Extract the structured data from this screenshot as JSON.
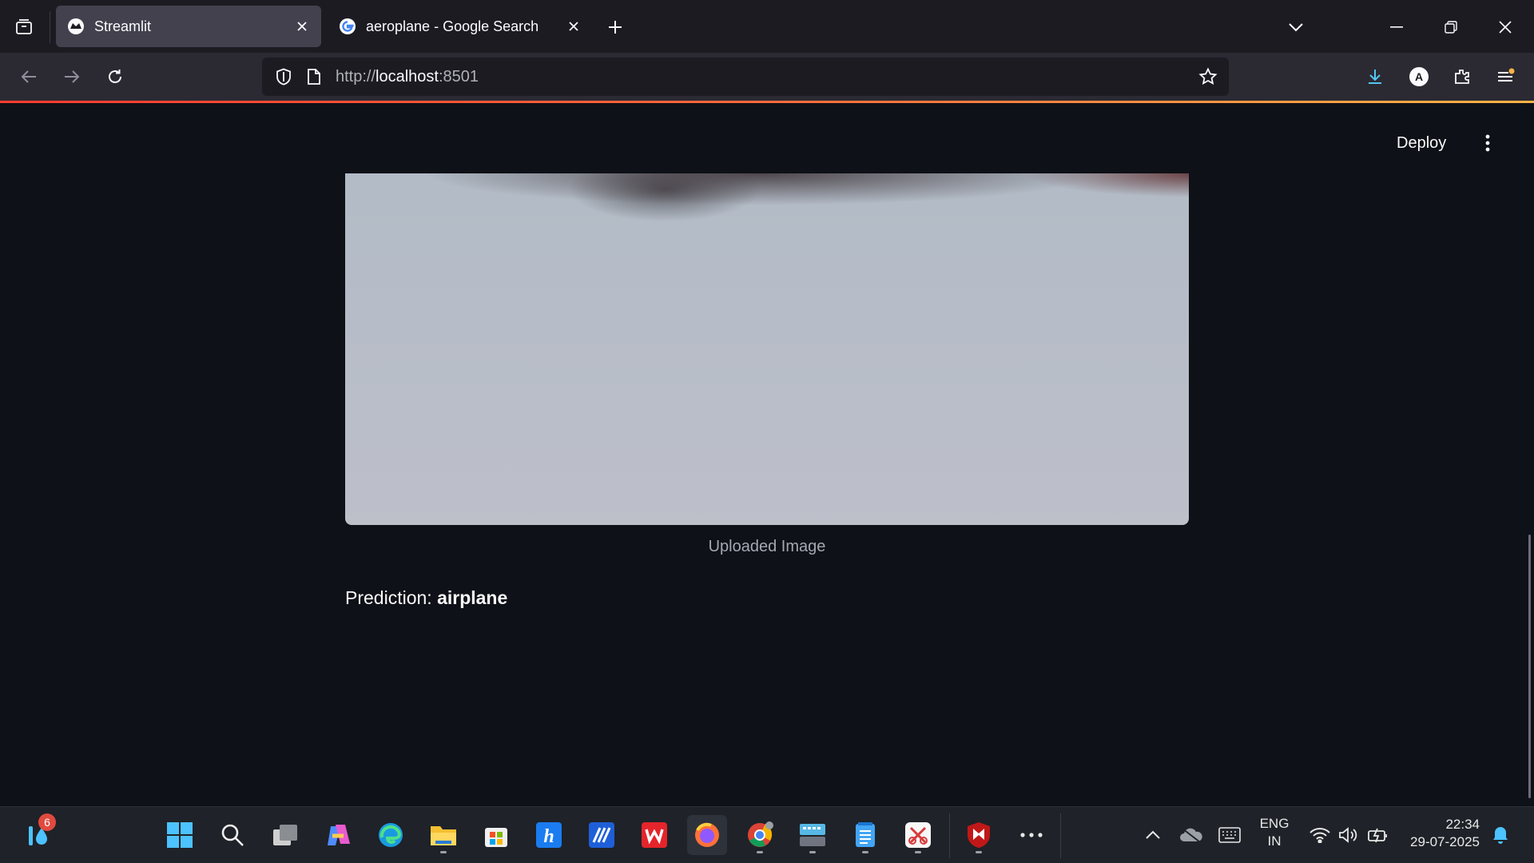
{
  "browser": {
    "tabs": [
      {
        "title": "Streamlit",
        "active": true
      },
      {
        "title": "aeroplane - Google Search",
        "active": false
      }
    ],
    "url_prefix": "http://",
    "url_host": "localhost",
    "url_port": ":8501",
    "profile_initial": "A"
  },
  "app": {
    "deploy_label": "Deploy",
    "image_caption": "Uploaded Image",
    "prediction_label": "Prediction: ",
    "prediction_value": "airplane"
  },
  "taskbar": {
    "widget_badge": "6",
    "language_line1": "ENG",
    "language_line2": "IN",
    "time": "22:34",
    "date": "29-07-2025"
  },
  "colors": {
    "app_background": "#0e1117",
    "tab_active": "#42414d",
    "taskbar_background": "#1f2228",
    "focus_indicator": "#4cc2ff"
  }
}
